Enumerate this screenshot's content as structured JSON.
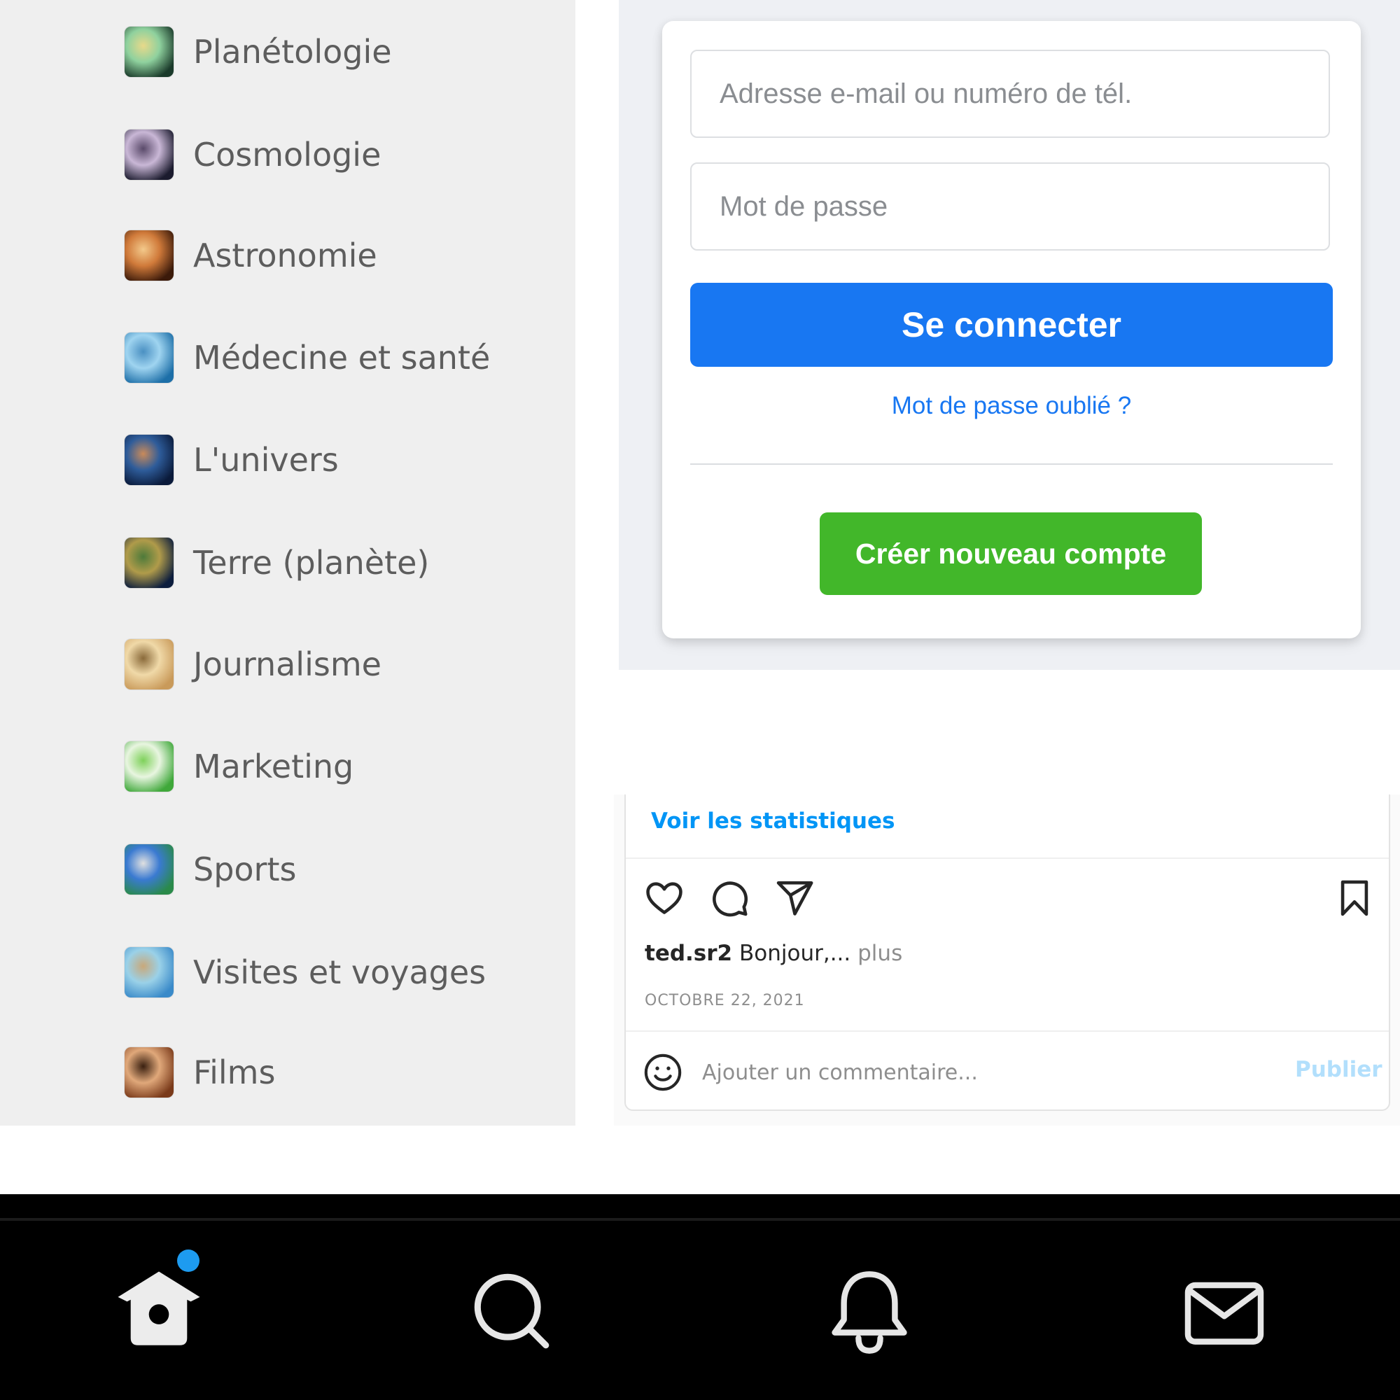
{
  "topics": [
    {
      "label": "Planétologie",
      "thumb_colors": [
        "#1a3a2a",
        "#8fd19e",
        "#e8d98a"
      ]
    },
    {
      "label": "Cosmologie",
      "thumb_colors": [
        "#1b1b2e",
        "#c9b7d6",
        "#5a4a6a"
      ]
    },
    {
      "label": "Astronomie",
      "thumb_colors": [
        "#3b1a0a",
        "#d07a3a",
        "#f3c98b"
      ]
    },
    {
      "label": "Médecine et santé",
      "thumb_colors": [
        "#1d6fa8",
        "#9fd4f0",
        "#4a90c2"
      ]
    },
    {
      "label": "L'univers",
      "thumb_colors": [
        "#0a1a3a",
        "#2e5c9a",
        "#c98a5a"
      ]
    },
    {
      "label": "Terre (planète)",
      "thumb_colors": [
        "#0c1d3d",
        "#b09b4a",
        "#4d7a3a"
      ]
    },
    {
      "label": "Journalisme",
      "thumb_colors": [
        "#c99a5a",
        "#f0d9a8",
        "#8a6a3a"
      ]
    },
    {
      "label": "Marketing",
      "thumb_colors": [
        "#3fa83a",
        "#e8f5e0",
        "#7ed15a"
      ]
    },
    {
      "label": "Sports",
      "thumb_colors": [
        "#2a8a4a",
        "#3a7ad1",
        "#e0e0e0"
      ]
    },
    {
      "label": "Visites et voyages",
      "thumb_colors": [
        "#3a8ac9",
        "#9ad1e8",
        "#c9a87a"
      ]
    },
    {
      "label": "Films",
      "thumb_colors": [
        "#7a3a1a",
        "#e0a87a",
        "#3a2010"
      ]
    }
  ],
  "login": {
    "email_placeholder": "Adresse e-mail ou numéro de tél.",
    "password_placeholder": "Mot de passe",
    "login_button": "Se connecter",
    "forgot_link": "Mot de passe oublié ?",
    "create_button": "Créer nouveau compte",
    "primary_color": "#1877f2",
    "create_color": "#42b72a"
  },
  "post": {
    "stats_link": "Voir les statistiques",
    "actions": [
      "heart-icon",
      "comment-icon",
      "share-icon",
      "bookmark-icon"
    ],
    "username": "ted.sr2",
    "caption": "Bonjour,...",
    "more_label": "plus",
    "date": "OCTOBRE 22, 2021",
    "comment_placeholder": "Ajouter un commentaire...",
    "publish_label": "Publier"
  },
  "navbar": {
    "items": [
      "home-icon",
      "search-icon",
      "bell-icon",
      "mail-icon"
    ],
    "home_has_notification": true,
    "notification_color": "#1d9bf0"
  }
}
